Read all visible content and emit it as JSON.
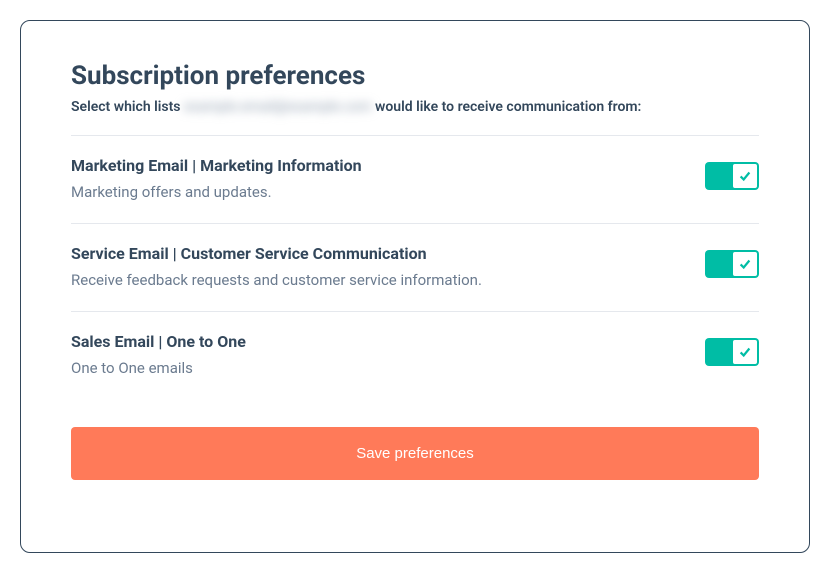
{
  "header": {
    "title": "Subscription preferences",
    "subtitle_prefix": "Select which lists ",
    "subtitle_blurred": "example.email@example.com",
    "subtitle_suffix": " would like to receive communication from:"
  },
  "preferences": [
    {
      "title": "Marketing Email | Marketing Information",
      "description": "Marketing offers and updates.",
      "enabled": true
    },
    {
      "title": "Service Email | Customer Service Communication",
      "description": "Receive feedback requests and customer service information.",
      "enabled": true
    },
    {
      "title": "Sales Email | One to One",
      "description": "One to One emails",
      "enabled": true
    }
  ],
  "actions": {
    "save_label": "Save preferences"
  },
  "colors": {
    "accent": "#00bda5",
    "primary_button": "#ff7a59",
    "text_dark": "#33475b",
    "text_muted": "#6b7b8f"
  }
}
